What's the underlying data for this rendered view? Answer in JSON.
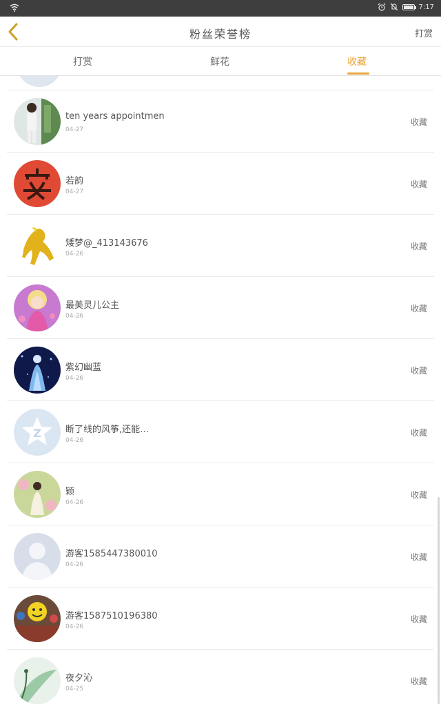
{
  "status": {
    "time": "7:17"
  },
  "header": {
    "title": "粉丝荣誉榜",
    "action": "打赏"
  },
  "tabs": [
    {
      "label": "打赏"
    },
    {
      "label": "鲜花"
    },
    {
      "label": "收藏"
    }
  ],
  "colors": {
    "accent": "#e9a53a"
  },
  "list": [
    {
      "name": "ten years appointmen",
      "date": "04-27",
      "action": "收藏",
      "avatar": "photo-boy"
    },
    {
      "name": "若韵",
      "date": "04-27",
      "action": "收藏",
      "avatar": "red-seal"
    },
    {
      "name": "矮梦@_413143676",
      "date": "04-26",
      "action": "收藏",
      "avatar": "golden-horse"
    },
    {
      "name": "最美灵儿公主",
      "date": "04-26",
      "action": "收藏",
      "avatar": "pink-princess"
    },
    {
      "name": "紫幻幽蓝",
      "date": "04-26",
      "action": "收藏",
      "avatar": "blue-fairy"
    },
    {
      "name": "断了线的风筝,还能…",
      "date": "04-26",
      "action": "收藏",
      "avatar": "qq-default"
    },
    {
      "name": "颖",
      "date": "04-26",
      "action": "收藏",
      "avatar": "flower-girl"
    },
    {
      "name": "游客1585447380010",
      "date": "04-26",
      "action": "收藏",
      "avatar": "default-person"
    },
    {
      "name": "游客1587510196380",
      "date": "04-26",
      "action": "收藏",
      "avatar": "smiley-balloon"
    },
    {
      "name": "夜夕沁",
      "date": "04-25",
      "action": "收藏",
      "avatar": "green-plant"
    }
  ]
}
